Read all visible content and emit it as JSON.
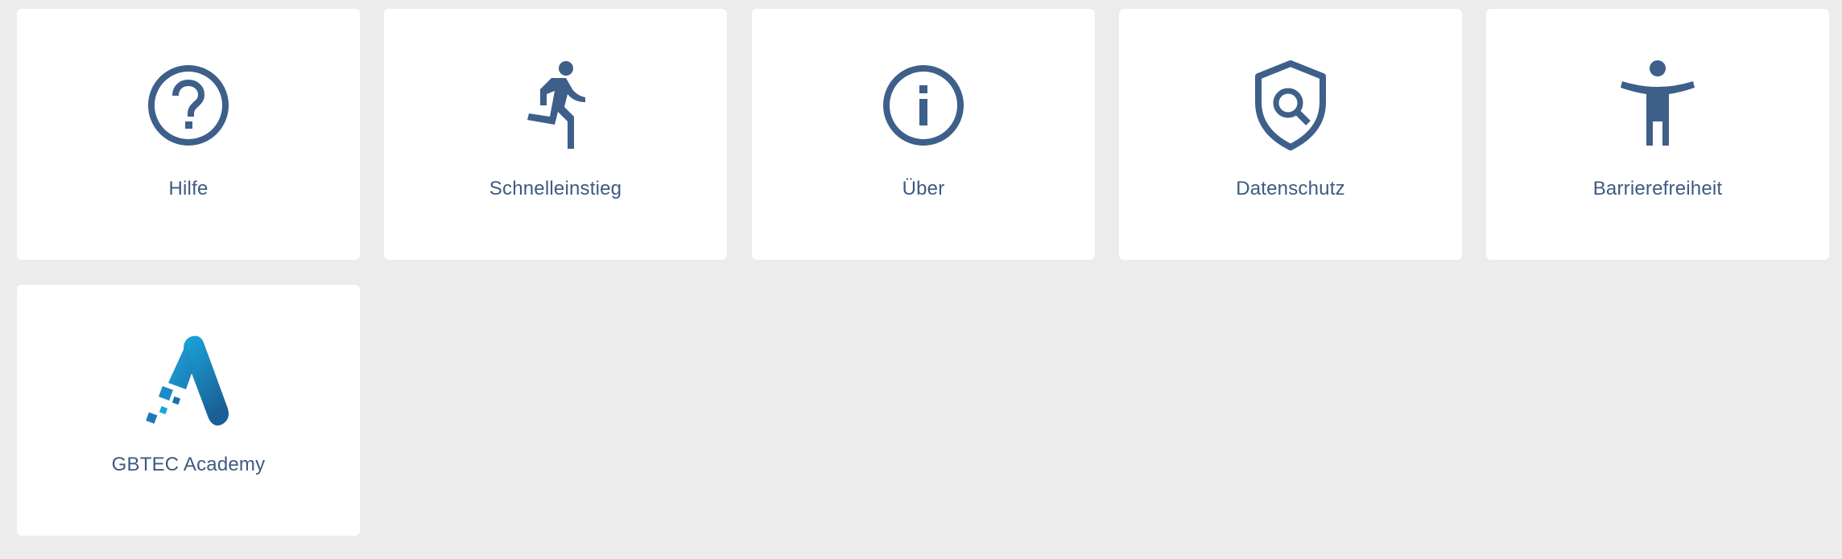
{
  "colors": {
    "background": "#ececec",
    "tile": "#ffffff",
    "icon": "#3d5f8a",
    "label": "#3d5a80",
    "academy_light": "#1aa6dc",
    "academy_dark": "#1a5f95"
  },
  "tiles": [
    {
      "label": "Hilfe",
      "icon": "help-circle-icon"
    },
    {
      "label": "Schnelleinstieg",
      "icon": "running-person-icon"
    },
    {
      "label": "Über",
      "icon": "info-circle-icon"
    },
    {
      "label": "Datenschutz",
      "icon": "shield-search-icon"
    },
    {
      "label": "Barrierefreiheit",
      "icon": "accessibility-icon"
    },
    {
      "label": "GBTEC Academy",
      "icon": "gbtec-academy-logo-icon"
    }
  ]
}
